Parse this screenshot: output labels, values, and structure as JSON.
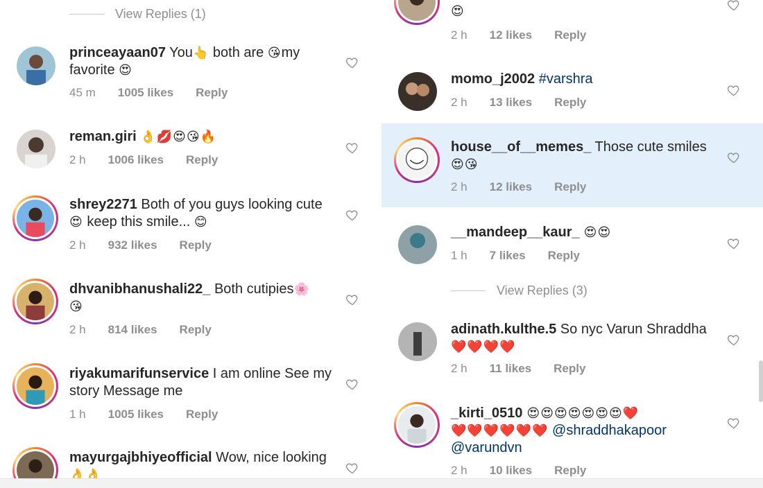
{
  "left": {
    "view_replies": "View Replies (1)",
    "comments": [
      {
        "username": "princeayaan07",
        "text_before": " You",
        "e1": "👆",
        "text_mid": " both are ",
        "e2": "😘",
        "text_after": "my favorite ",
        "e3": "😍",
        "time": "45 m",
        "likes": "1005 likes",
        "reply": "Reply"
      },
      {
        "username": "reman.giri",
        "text": " ",
        "emoji": "👌💋😍😘🔥",
        "time": "2 h",
        "likes": "1006 likes",
        "reply": "Reply"
      },
      {
        "username": "shrey2271",
        "text_before": " Both of you guys looking cute",
        "e1": "😍",
        "text_after": " keep this smile... ",
        "e2": "😊",
        "time": "2 h",
        "likes": "932 likes",
        "reply": "Reply"
      },
      {
        "username": "dhvanibhanushali22_",
        "text_before": " Both cutipies",
        "e1": "🌸",
        "e2": "😘",
        "time": "2 h",
        "likes": "814 likes",
        "reply": "Reply"
      },
      {
        "username": "riyakumarifunservice",
        "text": " I am online See my story Message me",
        "time": "1 h",
        "likes": "1005 likes",
        "reply": "Reply"
      },
      {
        "username": "mayurgajbhiyeofficial",
        "text": " Wow, nice looking",
        "emoji": "👌👌"
      }
    ]
  },
  "right": {
    "comments": [
      {
        "emoji": "😍",
        "time": "2 h",
        "likes": "12 likes",
        "reply": "Reply"
      },
      {
        "username": "momo_j2002",
        "hashtag": " #varshra",
        "time": "2 h",
        "likes": "13 likes",
        "reply": "Reply"
      },
      {
        "username": "house__of__memes_",
        "text": " Those cute smiles",
        "emoji": "😍😘",
        "time": "2 h",
        "likes": "12 likes",
        "reply": "Reply"
      },
      {
        "username": "__mandeep__kaur_",
        "emoji": " 😍😍",
        "time": "1 h",
        "likes": "7 likes",
        "reply": "Reply"
      },
      {
        "username": "adinath.kulthe.5",
        "text": " So nyc Varun Shraddha",
        "emoji": "❤️❤️❤️❤️",
        "time": "2 h",
        "likes": "11 likes",
        "reply": "Reply"
      },
      {
        "username": "_kirti_0510",
        "emoji1": " 😍😍😍😍😍😍😍❤️",
        "emoji2": "❤️❤️❤️❤️❤️❤️",
        "mention1": " @shraddhakapoor",
        "mention2": "@varundvn",
        "time": "2 h",
        "likes": "10 likes",
        "reply": "Reply"
      }
    ],
    "view_replies": "View Replies (3)"
  },
  "colors": {
    "text": "#262626",
    "meta": "#8e8e8e",
    "highlight": "#e3effb",
    "link": "#003569"
  }
}
